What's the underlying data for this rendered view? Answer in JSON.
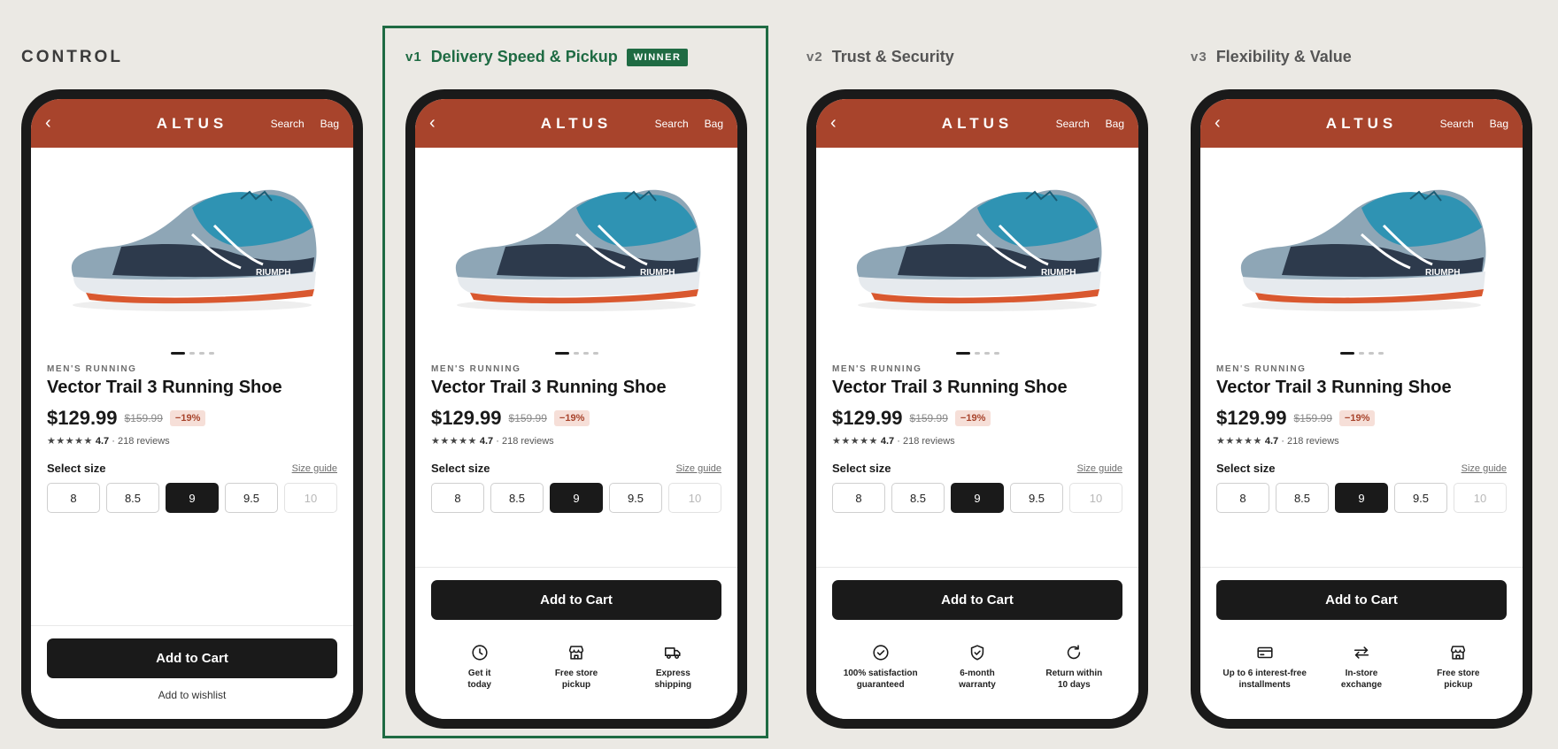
{
  "app": {
    "brand": "ALTUS",
    "nav_search": "Search",
    "nav_bag": "Bag",
    "back_symbol": "‹"
  },
  "product": {
    "category": "MEN'S RUNNING",
    "name": "Vector Trail 3 Running Shoe",
    "price": "$129.99",
    "old_price": "$159.99",
    "discount": "−19%",
    "stars": "★★★★★",
    "rating": "4.7",
    "reviews": "· 218 reviews",
    "image_slides": 4,
    "active_slide": 1
  },
  "sizes": {
    "label": "Select size",
    "guide": "Size guide",
    "options": [
      "8",
      "8.5",
      "9",
      "9.5",
      "10"
    ],
    "selected": "9",
    "unavailable": [
      "10"
    ]
  },
  "cta": {
    "add_to_cart": "Add to Cart",
    "wishlist": "Add to wishlist"
  },
  "colors": {
    "brand_bar": "#a8442c",
    "winner": "#1f6b43",
    "cta": "#1a1a1a"
  },
  "columns": {
    "control": {
      "title": "CONTROL"
    },
    "v1": {
      "version": "v1",
      "title": "Delivery Speed & Pickup",
      "badge": "WINNER",
      "features": [
        {
          "icon": "clock-icon",
          "text": "Get it\ntoday"
        },
        {
          "icon": "store-icon",
          "text": "Free store\npickup"
        },
        {
          "icon": "truck-icon",
          "text": "Express\nshipping"
        }
      ]
    },
    "v2": {
      "version": "v2",
      "title": "Trust & Security",
      "features": [
        {
          "icon": "check-circle-icon",
          "text": "100% satisfaction\nguaranteed"
        },
        {
          "icon": "shield-check-icon",
          "text": "6-month\nwarranty"
        },
        {
          "icon": "refresh-icon",
          "text": "Return within\n10 days"
        }
      ]
    },
    "v3": {
      "version": "v3",
      "title": "Flexibility & Value",
      "features": [
        {
          "icon": "credit-card-icon",
          "text": "Up to 6 interest-free\ninstallments"
        },
        {
          "icon": "swap-arrows-icon",
          "text": "In-store\nexchange"
        },
        {
          "icon": "store-icon",
          "text": "Free store\npickup"
        }
      ]
    }
  }
}
